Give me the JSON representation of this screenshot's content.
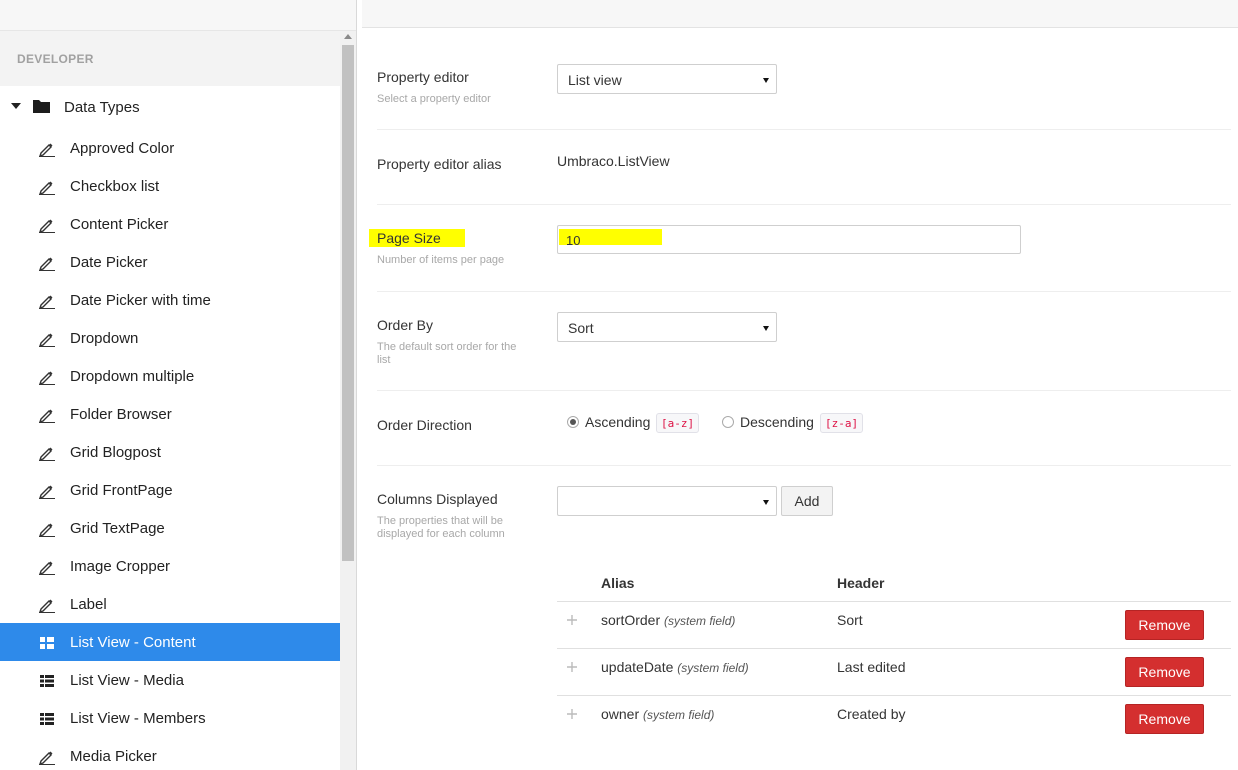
{
  "sidebar": {
    "section_title": "DEVELOPER",
    "root": {
      "label": "Data Types",
      "icon": "folder-icon"
    },
    "items": [
      {
        "label": "Approved Color",
        "icon": "pencil-icon",
        "active": false
      },
      {
        "label": "Checkbox list",
        "icon": "pencil-icon",
        "active": false
      },
      {
        "label": "Content Picker",
        "icon": "pencil-icon",
        "active": false
      },
      {
        "label": "Date Picker",
        "icon": "pencil-icon",
        "active": false
      },
      {
        "label": "Date Picker with time",
        "icon": "pencil-icon",
        "active": false
      },
      {
        "label": "Dropdown",
        "icon": "pencil-icon",
        "active": false
      },
      {
        "label": "Dropdown multiple",
        "icon": "pencil-icon",
        "active": false
      },
      {
        "label": "Folder Browser",
        "icon": "pencil-icon",
        "active": false
      },
      {
        "label": "Grid Blogpost",
        "icon": "pencil-icon",
        "active": false
      },
      {
        "label": "Grid FrontPage",
        "icon": "pencil-icon",
        "active": false
      },
      {
        "label": "Grid TextPage",
        "icon": "pencil-icon",
        "active": false
      },
      {
        "label": "Image Cropper",
        "icon": "pencil-icon",
        "active": false
      },
      {
        "label": "Label",
        "icon": "pencil-icon",
        "active": false
      },
      {
        "label": "List View - Content",
        "icon": "list-view-icon",
        "active": true
      },
      {
        "label": "List View - Media",
        "icon": "list-view-icon",
        "active": false
      },
      {
        "label": "List View - Members",
        "icon": "list-view-icon",
        "active": false
      },
      {
        "label": "Media Picker",
        "icon": "pencil-icon",
        "active": false
      }
    ]
  },
  "form": {
    "property_editor": {
      "label": "Property editor",
      "description": "Select a property editor",
      "value": "List view"
    },
    "property_editor_alias": {
      "label": "Property editor alias",
      "value": "Umbraco.ListView"
    },
    "page_size": {
      "label": "Page Size",
      "description": "Number of items per page",
      "value": "10"
    },
    "order_by": {
      "label": "Order By",
      "description": "The default sort order for the list",
      "value": "Sort"
    },
    "order_direction": {
      "label": "Order Direction",
      "options": [
        {
          "label": "Ascending",
          "tag": "[a-z]",
          "checked": true
        },
        {
          "label": "Descending",
          "tag": "[z-a]",
          "checked": false
        }
      ]
    },
    "columns_displayed": {
      "label": "Columns Displayed",
      "description": "The properties that will be displayed for each column",
      "select_value": "",
      "add_label": "Add",
      "table": {
        "headers": {
          "alias": "Alias",
          "header": "Header"
        },
        "rows": [
          {
            "alias": "sortOrder",
            "note": "(system field)",
            "header": "Sort",
            "remove_label": "Remove"
          },
          {
            "alias": "updateDate",
            "note": "(system field)",
            "header": "Last edited",
            "remove_label": "Remove"
          },
          {
            "alias": "owner",
            "note": "(system field)",
            "header": "Created by",
            "remove_label": "Remove"
          }
        ]
      }
    }
  },
  "colors": {
    "accent": "#2e8aea",
    "danger": "#d42f2f",
    "highlight": "#ffff00"
  }
}
